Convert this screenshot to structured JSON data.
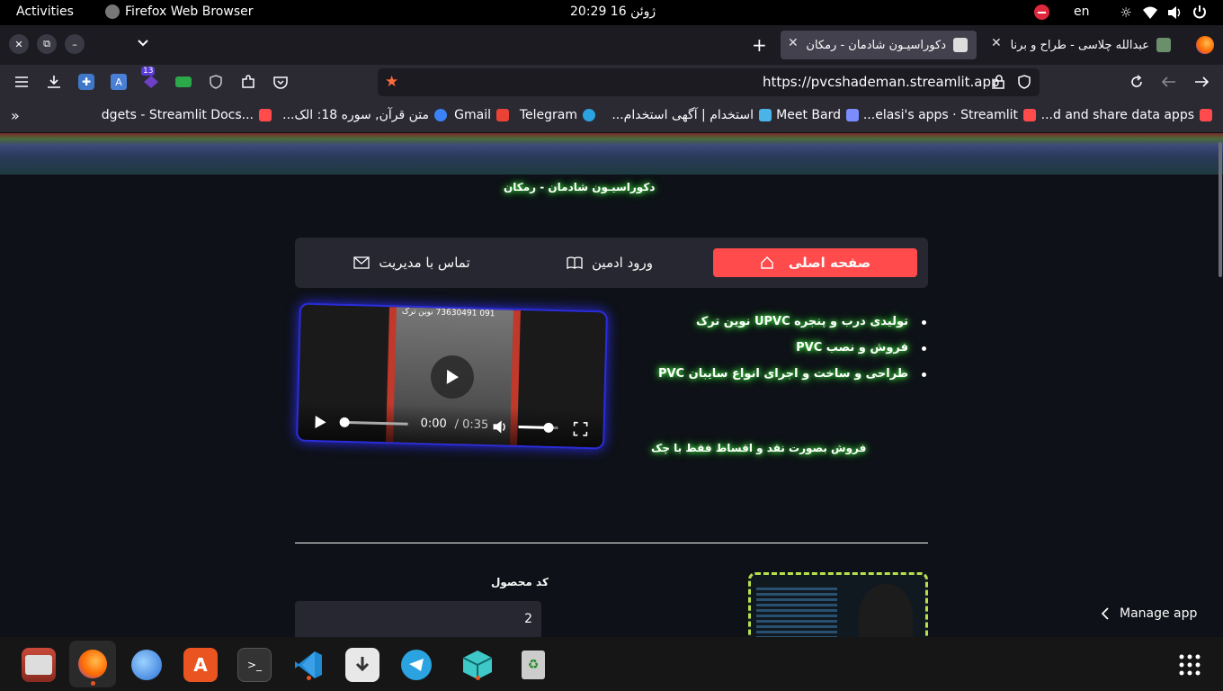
{
  "topbar": {
    "activities": "Activities",
    "app_name": "Firefox Web Browser",
    "clock": "20:29  16 ژوئن",
    "lang": "en"
  },
  "tabs": [
    {
      "title": "عبدالله چلاسی - طراح و برنا",
      "active": false
    },
    {
      "title": "دکوراسیـون شادمان - رمکان",
      "active": true
    }
  ],
  "navbar": {
    "url": "https://pvcshademan.streamlit.app",
    "badge_count": "13"
  },
  "bookmarks": [
    {
      "label": "d and share data apps...",
      "color": "#ff4b4b"
    },
    {
      "label": "elasi's apps · Streamlit...",
      "color": "#ff4b4b"
    },
    {
      "label": "Meet Bard",
      "color": "#7b8cff"
    },
    {
      "label": "استخدام | آگهی استخدام...",
      "color": "#4ab3e8"
    },
    {
      "label": "Telegram",
      "color": "#2aa3e0"
    },
    {
      "label": "Gmail",
      "color": "#ea4335"
    },
    {
      "label": "متن قرآن, سوره 18: الک...",
      "color": "#3b82f6"
    },
    {
      "label": "...dgets - Streamlit Docs",
      "color": "#ff4b4b"
    }
  ],
  "page": {
    "site_title": "دکوراسیـون شادمان - رمکان",
    "menu": [
      {
        "label": "صفحه اصلی",
        "active": true
      },
      {
        "label": "ورود ادمین",
        "active": false
      },
      {
        "label": "تماس با مدیریت",
        "active": false
      }
    ],
    "bullets": [
      "تولیدی درب و پنجره UPVC نوین ترک",
      "فروش و نصب PVC",
      "طراحی و ساخت و اجرای انواع سایبان PVC"
    ],
    "payment_note": "فروش بصورت نقد و اقساط فقط با چک",
    "video": {
      "current_time": "0:00",
      "duration": "/ 0:35",
      "overlay_text": "091 73630491 نوین ترک",
      "volume_level": 0.75
    },
    "product_code_label": "کد محصول",
    "product_code_value": "2",
    "manage_app": "Manage app"
  }
}
